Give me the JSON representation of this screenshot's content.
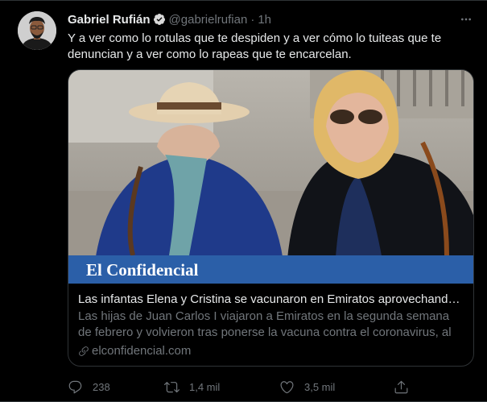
{
  "user": {
    "name": "Gabriel Rufián",
    "handle": "@gabrielrufian",
    "separator": "·",
    "time": "1h"
  },
  "tweet": {
    "text": "Y a ver como lo rotulas que te despiden y a ver cómo lo tuiteas que te denuncian y a ver como lo rapeas que te encarcelan."
  },
  "card": {
    "brand": "El Confidencial",
    "title": "Las infantas Elena y Cristina se vacunaron en Emiratos aprovechando u...",
    "description": "Las hijas de Juan Carlos I viajaron a Emiratos en la segunda semana de febrero y volvieron tras ponerse la vacuna contra el coronavirus, al igu...",
    "domain": "elconfidencial.com"
  },
  "actions": {
    "reply_count": "238",
    "retweet_count": "1,4 mil",
    "like_count": "3,5 mil"
  },
  "colors": {
    "background": "#000000",
    "text_primary": "#e7e9ea",
    "text_secondary": "#71767b",
    "verified": "#1d9bf0",
    "brand_banner": "#2b5fa8"
  },
  "icons": [
    "verified-badge-icon",
    "more-icon",
    "link-icon",
    "reply-icon",
    "retweet-icon",
    "like-icon",
    "share-icon"
  ]
}
